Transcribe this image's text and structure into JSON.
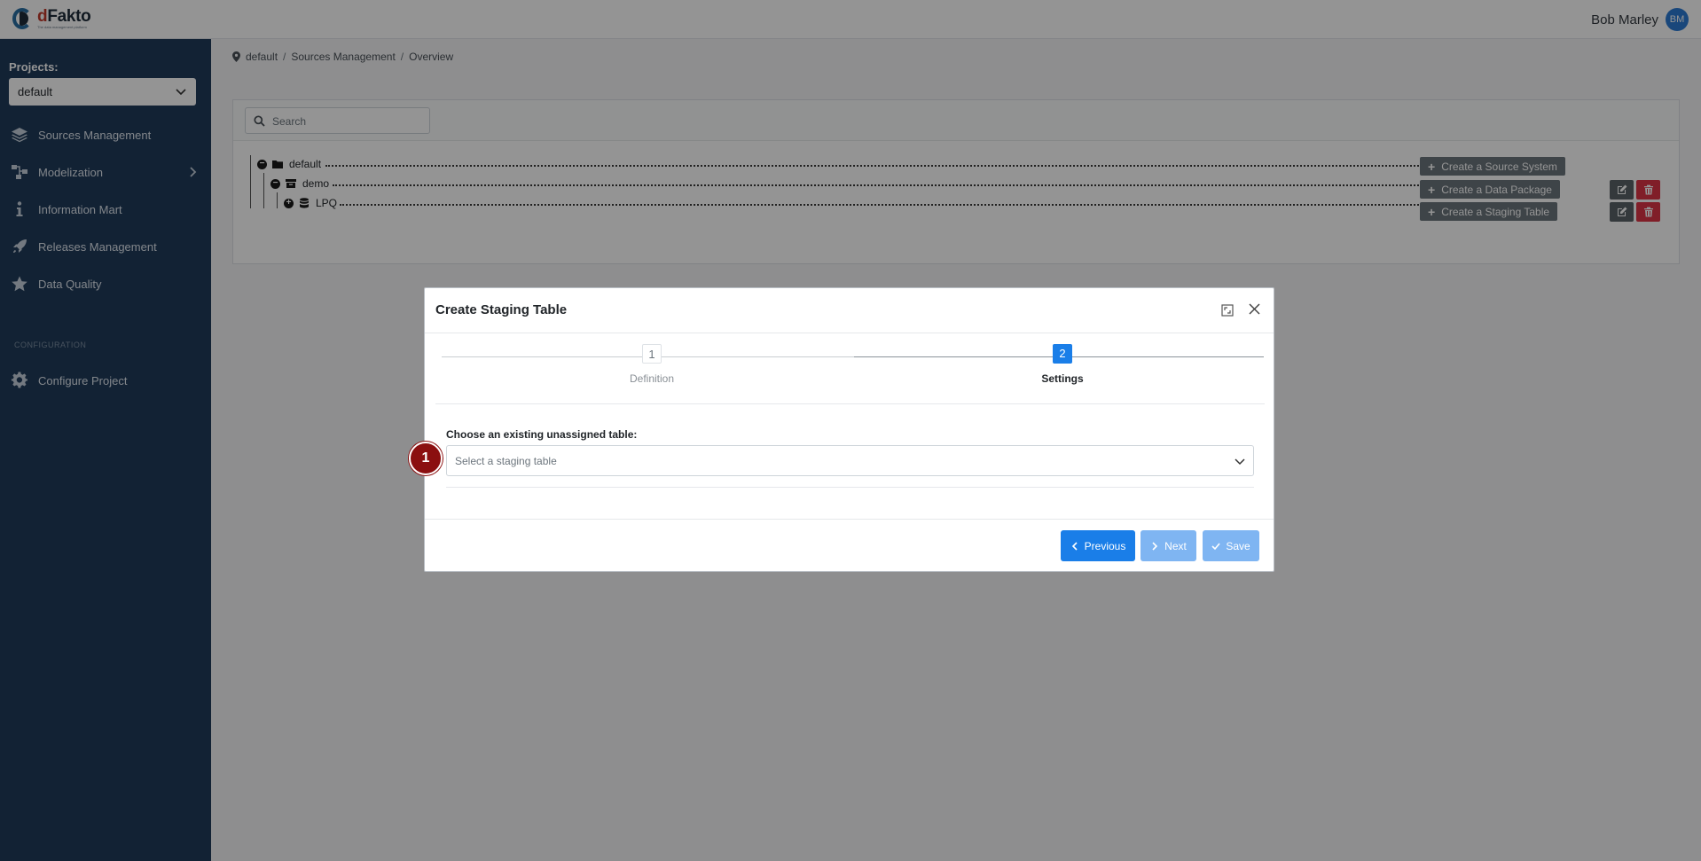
{
  "app": {
    "logo_name_d": "d",
    "logo_name_rest": "Fakto",
    "logo_tagline": "The data management platform"
  },
  "user": {
    "name": "Bob Marley",
    "initials": "BM"
  },
  "sidebar": {
    "projects_label": "Projects:",
    "project_selected": "default",
    "items": [
      {
        "label": "Sources Management",
        "icon": "layers-icon"
      },
      {
        "label": "Modelization",
        "icon": "diagram-icon"
      },
      {
        "label": "Information Mart",
        "icon": "info-icon"
      },
      {
        "label": "Releases Management",
        "icon": "rocket-icon"
      },
      {
        "label": "Data Quality",
        "icon": "star-icon"
      }
    ],
    "section_label": "CONFIGURATION",
    "config_items": [
      {
        "label": "Configure Project",
        "icon": "gear-icon"
      }
    ]
  },
  "breadcrumb": [
    "default",
    "Sources Management",
    "Overview"
  ],
  "search": {
    "placeholder": "Search"
  },
  "tree": {
    "nodes": [
      {
        "label": "default",
        "action": "Create a Source System"
      },
      {
        "label": "demo",
        "action": "Create a Data Package"
      },
      {
        "label": "LPQ",
        "action": "Create a Staging Table"
      }
    ]
  },
  "modal": {
    "title": "Create Staging Table",
    "steps": [
      {
        "number": "1",
        "label": "Definition"
      },
      {
        "number": "2",
        "label": "Settings"
      }
    ],
    "field_label": "Choose an existing unassigned table:",
    "select_placeholder": "Select a staging table",
    "buttons": {
      "previous": "Previous",
      "next": "Next",
      "save": "Save"
    }
  },
  "marker": {
    "number": "1"
  },
  "colors": {
    "sidebar_bg": "#1f3b5a",
    "primary": "#1a7ee8",
    "danger": "#dc3545",
    "marker": "#8b0f10"
  }
}
